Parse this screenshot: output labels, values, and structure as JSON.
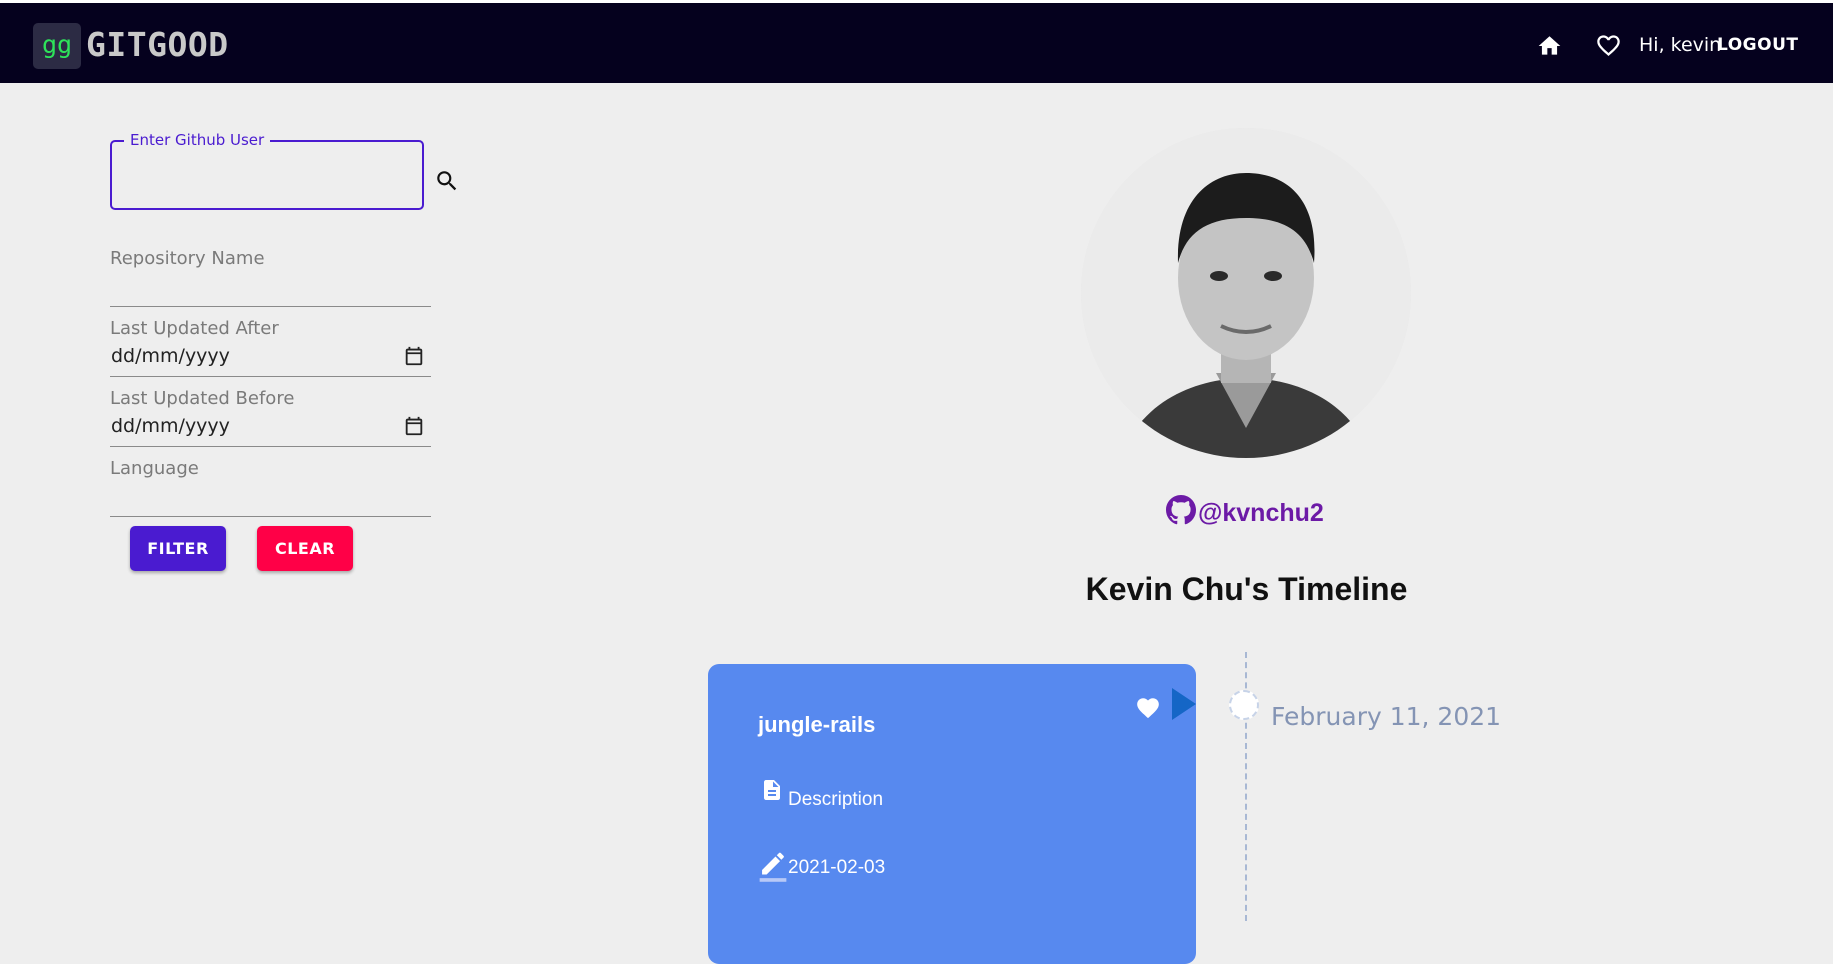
{
  "navbar": {
    "logo_mark": "gg",
    "logo_text": "GITGOOD",
    "greeting": "Hi, kevin",
    "logout_label": "LOGOUT",
    "background": "#05011e"
  },
  "filters": {
    "github_user": {
      "label": "Enter Github User",
      "value": ""
    },
    "repository_name": {
      "label": "Repository Name",
      "value": ""
    },
    "last_updated_after": {
      "label": "Last Updated After",
      "value": "dd/mm/yyyy"
    },
    "last_updated_before": {
      "label": "Last Updated Before",
      "value": "dd/mm/yyyy"
    },
    "language": {
      "label": "Language",
      "value": ""
    },
    "filter_label": "FILTER",
    "clear_label": "CLEAR"
  },
  "profile": {
    "handle": "@kvnchu2",
    "timeline_title": "Kevin Chu's Timeline"
  },
  "timeline": {
    "items": [
      {
        "repo_name": "jungle-rails",
        "description": "Description",
        "updated": "2021-02-03",
        "date": "February 11, 2021"
      }
    ]
  },
  "colors": {
    "accent": "#4a1bd0",
    "danger": "#ff0047",
    "card": "#5789ef",
    "handle": "#6c1aa6"
  },
  "icons": [
    "home-icon",
    "heart-outline-icon",
    "search-icon",
    "calendar-icon",
    "github-icon",
    "heart-icon",
    "description-icon",
    "edit-icon"
  ]
}
